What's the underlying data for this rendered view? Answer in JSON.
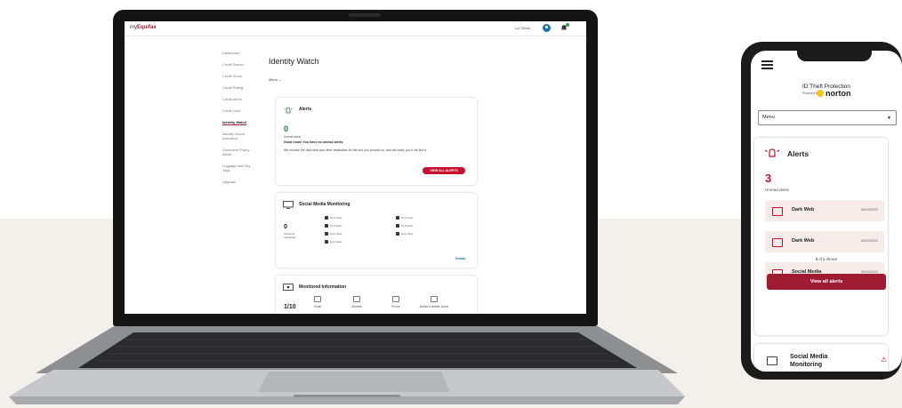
{
  "colors": {
    "brand_red": "#c8102e",
    "dark_red": "#9e1b32",
    "green": "#237e3c",
    "link_blue": "#1f6fb2"
  },
  "laptop": {
    "brand": {
      "prefix": "my",
      "name": "Equifax"
    },
    "user": {
      "name": "Liz Olivas"
    },
    "icons": {
      "avatar": "user-avatar-icon",
      "bell": "bell-icon"
    },
    "nav": [
      "Dashboard",
      "Credit Report",
      "Credit Score",
      "Credit Rating",
      "Credit Alerts",
      "Credit Lock",
      "Identity Watch",
      "Identity Guard Insurance",
      "Document Expiry Alerts",
      "Luggage and Key Tags",
      "Upgrade"
    ],
    "active_nav": "Identity Watch",
    "page_title": "Identity Watch",
    "menu_label": "Menu",
    "alerts_card": {
      "title": "Alerts",
      "count": "0",
      "count_label": "Unread alerts",
      "good_news": "Good news! You have no unread alerts.",
      "monitor_text": "We monitor the dark web and other databases for the info you provide us, and will notify you if we find it.",
      "button": "VIEW ALL ALERTS"
    },
    "social_card": {
      "title": "Social Media Monitoring",
      "count": "0",
      "count_label": "Accounts monitored",
      "links": [
        "Not linked",
        "Not linked",
        "Not linked",
        "Not linked",
        "Not linked",
        "Not linked",
        "Not linked"
      ],
      "details": "Details"
    },
    "monitor_card": {
      "title": "Monitored Information",
      "count": "1/10",
      "items": [
        "Email",
        "Address",
        "Phone",
        "Mother's Maiden Name"
      ]
    }
  },
  "phone": {
    "title": "ID Theft Protection",
    "powered_by": "Powered by",
    "partner": "norton",
    "menu_label": "Menu",
    "alerts": {
      "title": "Alerts",
      "count": "3",
      "count_label": "Unread alerts",
      "items": [
        {
          "label": "Dark Web",
          "date": "06/29/2022"
        },
        {
          "label": "Dark Web",
          "date": "06/29/2022"
        },
        {
          "label": "Social Media",
          "date": "06/29/2022"
        }
      ],
      "shown": {
        "count": "3",
        "text": "of 5 shown"
      },
      "button": "View all alerts"
    },
    "social": {
      "title": "Social Media Monitoring"
    }
  }
}
